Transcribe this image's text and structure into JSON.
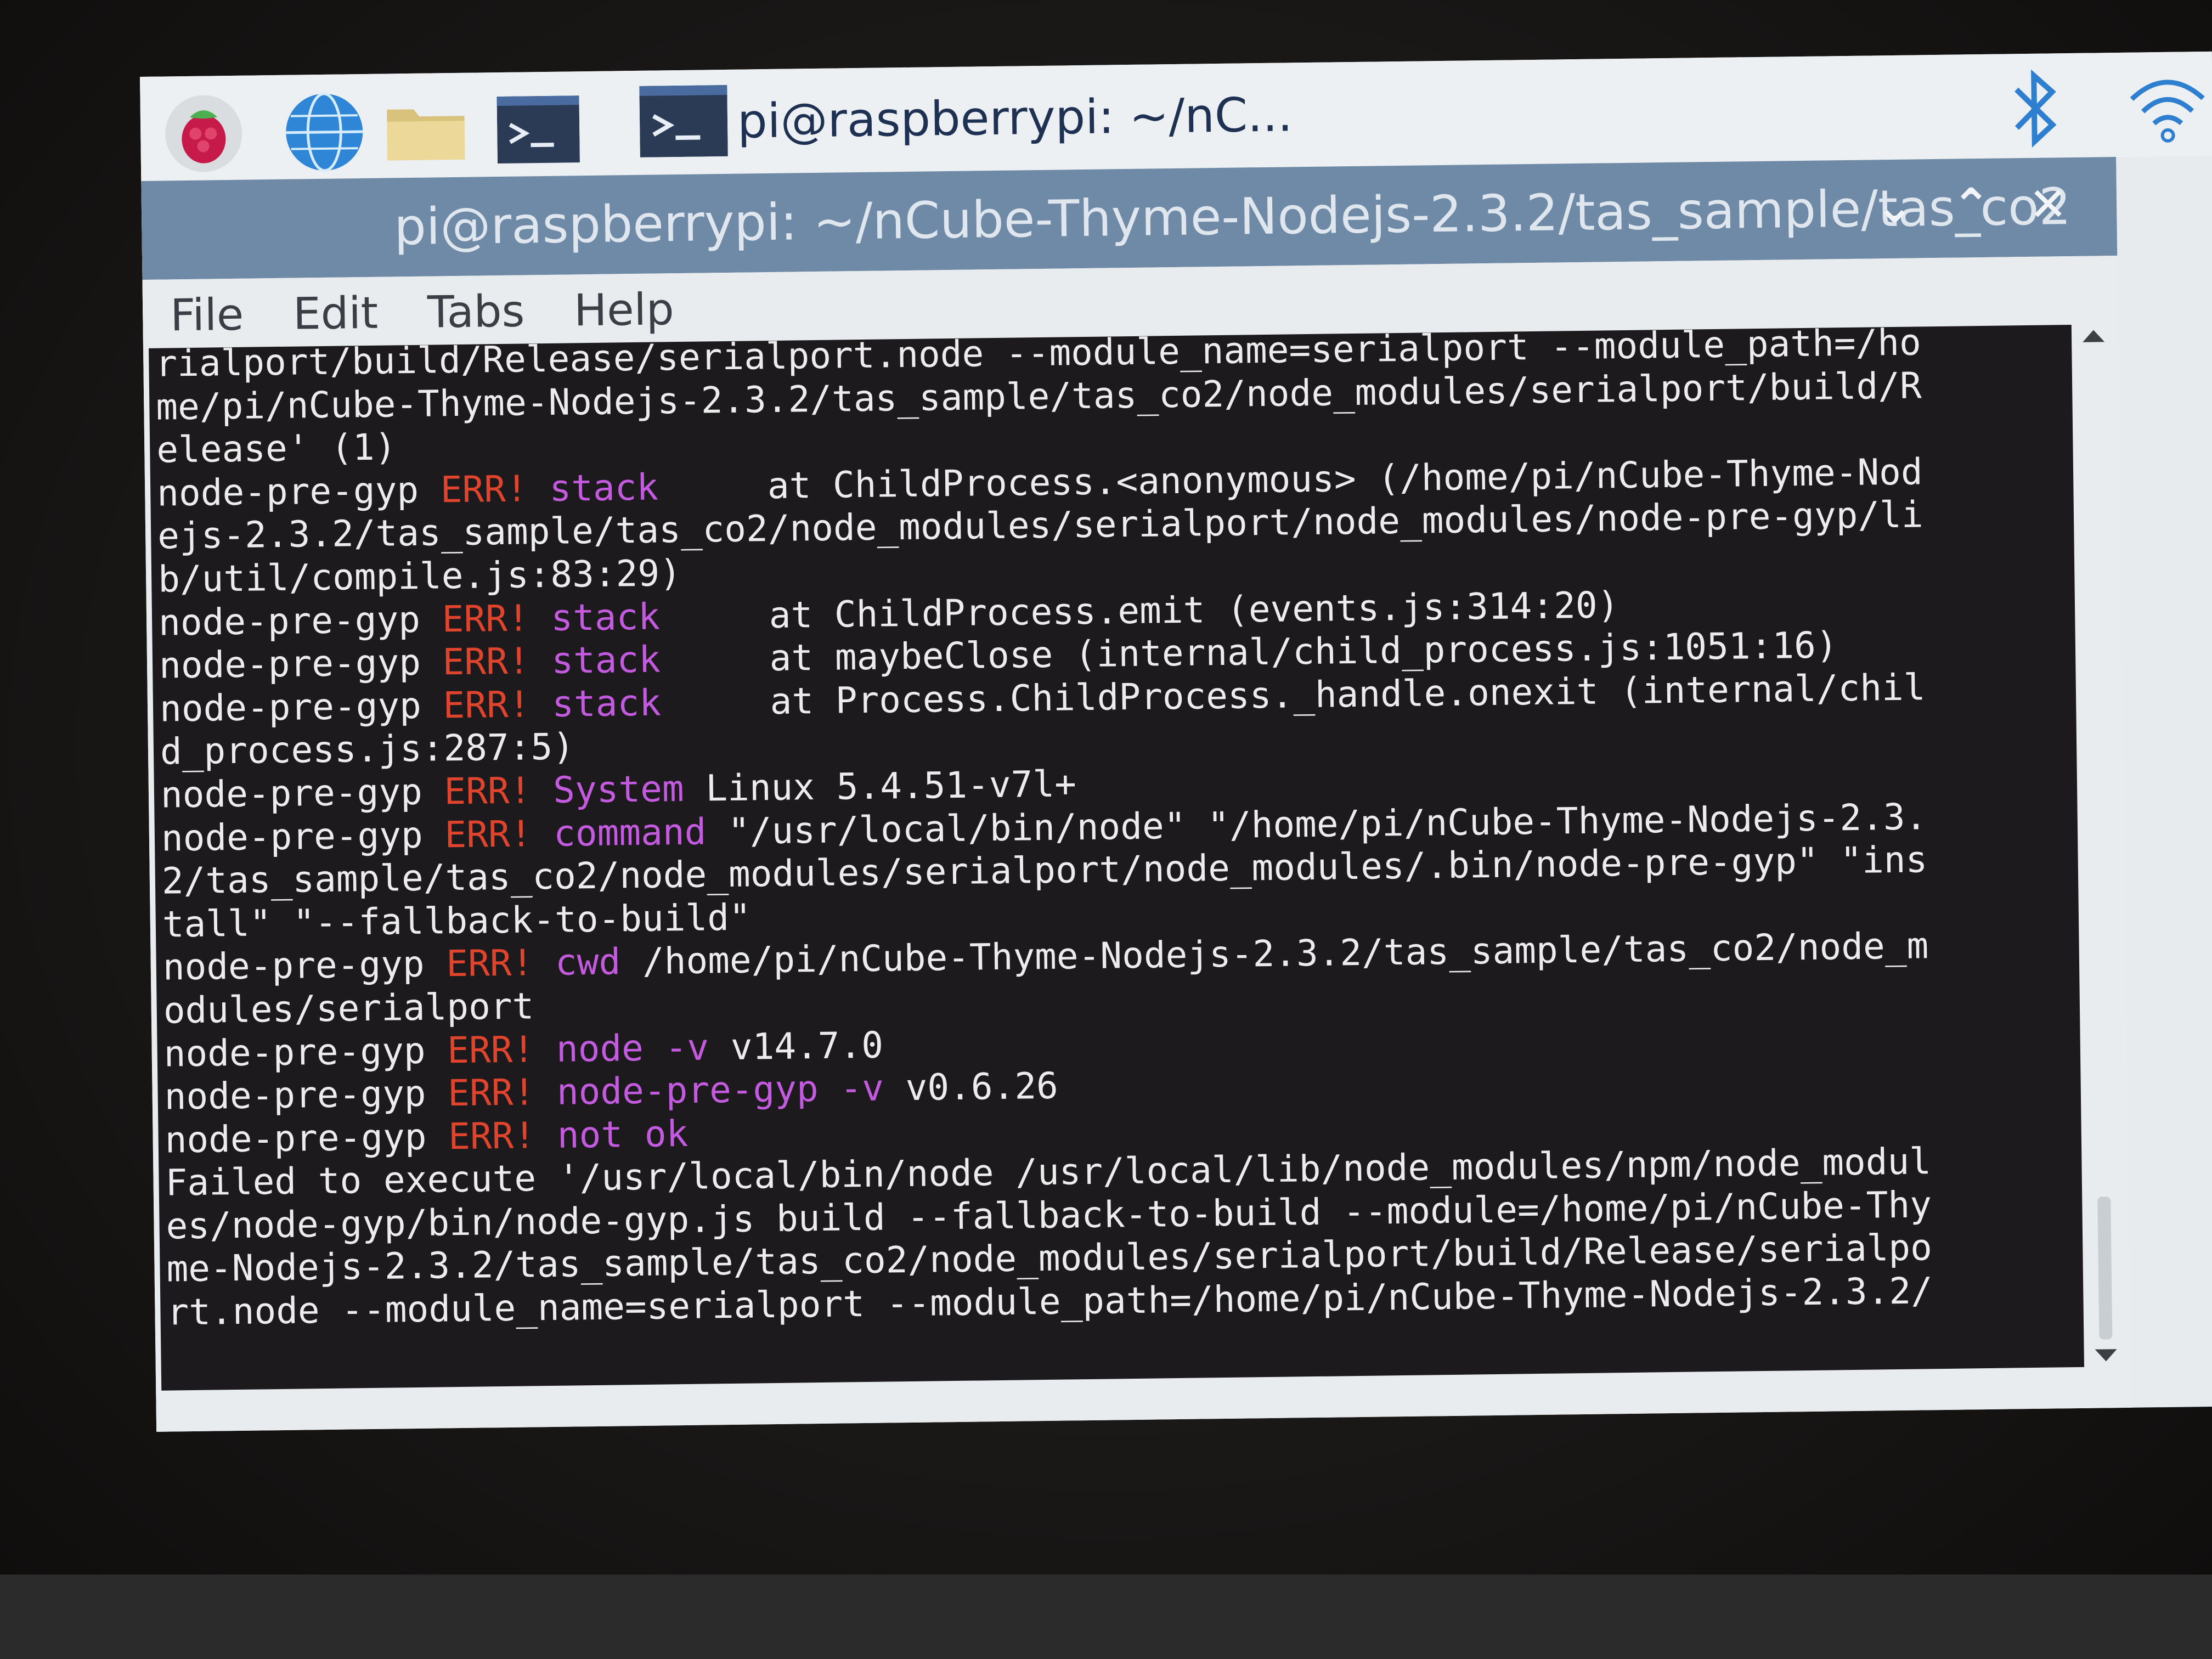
{
  "taskbar": {
    "launchers": [
      {
        "icon": "raspberry-menu-icon"
      },
      {
        "icon": "web-browser-globe-icon"
      },
      {
        "icon": "file-manager-folder-icon"
      },
      {
        "icon": "terminal-icon"
      }
    ],
    "task_label": "pi@raspberrypi: ~/nC...",
    "tray": [
      {
        "icon": "bluetooth-icon"
      },
      {
        "icon": "wifi-icon"
      }
    ]
  },
  "window": {
    "title": "pi@raspberrypi: ~/nCube-Thyme-Nodejs-2.3.2/tas_sample/tas_co2",
    "buttons": {
      "minimize": "⌄",
      "maximize": "⌃",
      "close": "✕"
    },
    "menu": [
      "File",
      "Edit",
      "Tabs",
      "Help"
    ]
  },
  "terminal": {
    "colors": {
      "background": "#1c1a1c",
      "text": "#e8e8e8",
      "err": "#e0442c",
      "keyword": "#c45ae0"
    },
    "lines": [
      [
        {
          "t": "rialport/build/Release/serialport.node --module_name=serialport --module_path=/ho",
          "c": "wht"
        }
      ],
      [
        {
          "t": "me/pi/nCube-Thyme-Nodejs-2.3.2/tas_sample/tas_co2/node_modules/serialport/build/R",
          "c": "wht"
        }
      ],
      [
        {
          "t": "elease' (1)",
          "c": "wht"
        }
      ],
      [
        {
          "t": "node-pre-gyp ",
          "c": "wht"
        },
        {
          "t": "ERR!",
          "c": "red"
        },
        {
          "t": " stack",
          "c": "mag"
        },
        {
          "t": "     at ChildProcess.<anonymous> (/home/pi/nCube-Thyme-Nod",
          "c": "wht"
        }
      ],
      [
        {
          "t": "ejs-2.3.2/tas_sample/tas_co2/node_modules/serialport/node_modules/node-pre-gyp/li",
          "c": "wht"
        }
      ],
      [
        {
          "t": "b/util/compile.js:83:29)",
          "c": "wht"
        }
      ],
      [
        {
          "t": "node-pre-gyp ",
          "c": "wht"
        },
        {
          "t": "ERR!",
          "c": "red"
        },
        {
          "t": " stack",
          "c": "mag"
        },
        {
          "t": "     at ChildProcess.emit (events.js:314:20)",
          "c": "wht"
        }
      ],
      [
        {
          "t": "node-pre-gyp ",
          "c": "wht"
        },
        {
          "t": "ERR!",
          "c": "red"
        },
        {
          "t": " stack",
          "c": "mag"
        },
        {
          "t": "     at maybeClose (internal/child_process.js:1051:16)",
          "c": "wht"
        }
      ],
      [
        {
          "t": "node-pre-gyp ",
          "c": "wht"
        },
        {
          "t": "ERR!",
          "c": "red"
        },
        {
          "t": " stack",
          "c": "mag"
        },
        {
          "t": "     at Process.ChildProcess._handle.onexit (internal/chil",
          "c": "wht"
        }
      ],
      [
        {
          "t": "d_process.js:287:5)",
          "c": "wht"
        }
      ],
      [
        {
          "t": "node-pre-gyp ",
          "c": "wht"
        },
        {
          "t": "ERR!",
          "c": "red"
        },
        {
          "t": " System",
          "c": "mag"
        },
        {
          "t": " Linux 5.4.51-v7l+",
          "c": "wht"
        }
      ],
      [
        {
          "t": "node-pre-gyp ",
          "c": "wht"
        },
        {
          "t": "ERR!",
          "c": "red"
        },
        {
          "t": " command",
          "c": "mag"
        },
        {
          "t": " \"/usr/local/bin/node\" \"/home/pi/nCube-Thyme-Nodejs-2.3.",
          "c": "wht"
        }
      ],
      [
        {
          "t": "2/tas_sample/tas_co2/node_modules/serialport/node_modules/.bin/node-pre-gyp\" \"ins",
          "c": "wht"
        }
      ],
      [
        {
          "t": "tall\" \"--fallback-to-build\"",
          "c": "wht"
        }
      ],
      [
        {
          "t": "node-pre-gyp ",
          "c": "wht"
        },
        {
          "t": "ERR!",
          "c": "red"
        },
        {
          "t": " cwd",
          "c": "mag"
        },
        {
          "t": " /home/pi/nCube-Thyme-Nodejs-2.3.2/tas_sample/tas_co2/node_m",
          "c": "wht"
        }
      ],
      [
        {
          "t": "odules/serialport",
          "c": "wht"
        }
      ],
      [
        {
          "t": "node-pre-gyp ",
          "c": "wht"
        },
        {
          "t": "ERR!",
          "c": "red"
        },
        {
          "t": " node -v",
          "c": "mag"
        },
        {
          "t": " v14.7.0",
          "c": "wht"
        }
      ],
      [
        {
          "t": "node-pre-gyp ",
          "c": "wht"
        },
        {
          "t": "ERR!",
          "c": "red"
        },
        {
          "t": " node-pre-gyp -v",
          "c": "mag"
        },
        {
          "t": " v0.6.26",
          "c": "wht"
        }
      ],
      [
        {
          "t": "node-pre-gyp ",
          "c": "wht"
        },
        {
          "t": "ERR!",
          "c": "red"
        },
        {
          "t": " not ok",
          "c": "mag"
        }
      ],
      [
        {
          "t": "Failed to execute '/usr/local/bin/node /usr/local/lib/node_modules/npm/node_modul",
          "c": "wht"
        }
      ],
      [
        {
          "t": "es/node-gyp/bin/node-gyp.js build --fallback-to-build --module=/home/pi/nCube-Thy",
          "c": "wht"
        }
      ],
      [
        {
          "t": "me-Nodejs-2.3.2/tas_sample/tas_co2/node_modules/serialport/build/Release/serialpo",
          "c": "wht"
        }
      ],
      [
        {
          "t": "rt.node --module_name=serialport --module_path=/home/pi/nCube-Thyme-Nodejs-2.3.2/",
          "c": "wht"
        }
      ]
    ]
  }
}
